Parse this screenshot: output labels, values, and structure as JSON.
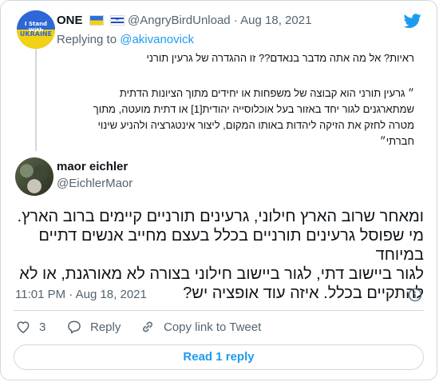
{
  "parent": {
    "name": "ONE",
    "handle": "@AngryBirdUnload",
    "date": "Aug 18, 2021",
    "avatar_text_top": "I Stand With",
    "avatar_text_bottom": "UKRAINE",
    "replying_prefix": "Replying to",
    "replying_handle": "@akivanovick",
    "text_line1": "ראיות? אל מה אתה מדבר בנאדם?? זו ההגדרה של גרעין תורני",
    "text_para": [
      "״ גרעין תורני הוא קבוצה של משפחות או יחידים מתוך הציונות הדתית",
      "שמתארגנים לגור יחד באזור בעל אוכלוסייה יהודית[1] או דתית מועטה, מתוך",
      "מטרה לחזק את הזיקה ליהדות באותו המקום, ליצור אינטגרציה ולהניע שינוי",
      "חברתי״"
    ]
  },
  "main": {
    "name": "maor eichler",
    "handle": "@EichlerMaor",
    "text_lines": [
      "ומאחר שרוב הארץ חילוני, גרעינים תורניים קיימים ברוב הארץ.",
      "מי שפוסל גרעינים תורניים בכלל בעצם מחייב אנשים דתיים במיוחד",
      "לגור ביישוב דתי, לגור ביישוב חילוני בצורה לא מאורגנת, או לא",
      "להתקיים בכלל. איזה עוד אופציה יש?"
    ],
    "time": "11:01 PM",
    "date": "Aug 18, 2021",
    "separator": "·"
  },
  "actions": {
    "like_count": "3",
    "reply_label": "Reply",
    "copy_label": "Copy link to Tweet"
  },
  "read_replies_label": "Read 1 reply",
  "colors": {
    "accent": "#1d9bf0",
    "text": "#0f1419",
    "secondary": "#536471",
    "border": "#cfd9de"
  },
  "icons": [
    "twitter-bird-icon",
    "info-icon",
    "heart-icon",
    "reply-icon",
    "link-icon"
  ]
}
